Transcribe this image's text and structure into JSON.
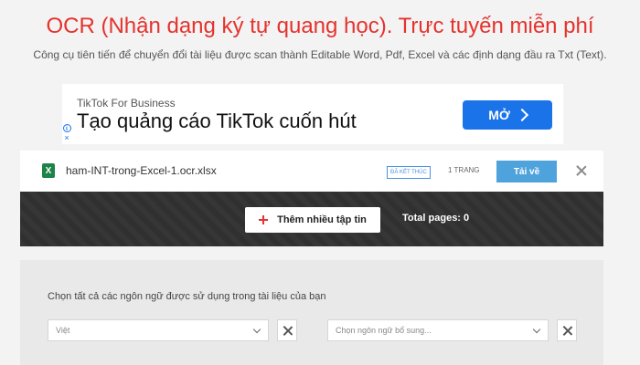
{
  "header": {
    "title": "OCR (Nhận dạng ký tự quang học). Trực tuyến miễn phí",
    "subtitle": "Công cụ tiên tiến để chuyển đổi tài liệu được scan thành Editable Word, Pdf, Excel và các định dạng đầu ra Txt (Text)."
  },
  "ad": {
    "brand": "TikTok For Business",
    "headline": "Tạo quảng cáo TikTok cuốn hút",
    "button_label": "MỞ",
    "info_glyph": "i",
    "close_glyph": "×",
    "button_color": "#1a73e8"
  },
  "file": {
    "icon_glyph": "X",
    "name": "ham-INT-trong-Excel-1.ocr.xlsx",
    "status": "ĐÃ KẾT THÚC",
    "pages": "1 TRANG",
    "download_label": "Tải về",
    "download_color": "#4fa3dc"
  },
  "toolbar": {
    "add_files_label": "Thêm nhiều tập tin",
    "total_pages": "Total pages: 0"
  },
  "language": {
    "prompt": "Chọn tất cả các ngôn ngữ được sử dụng trong tài liệu của bạn",
    "primary_value": "Việt",
    "secondary_placeholder": "Chọn ngôn ngữ bổ sung..."
  },
  "colors": {
    "brand_red": "#e5322d",
    "status_blue": "#4a90e2"
  }
}
